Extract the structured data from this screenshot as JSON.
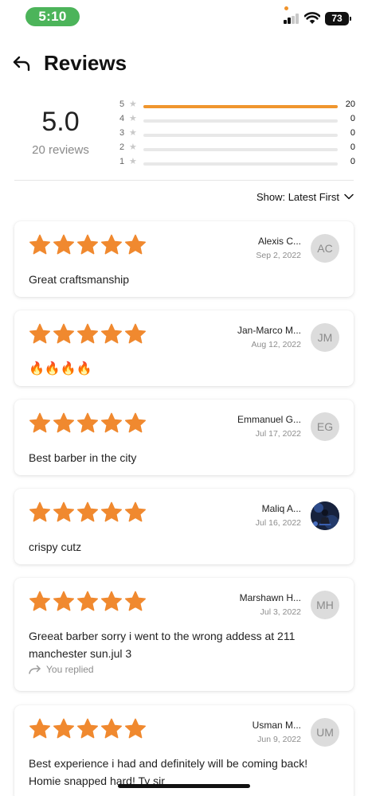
{
  "status_bar": {
    "time": "5:10",
    "battery": "73"
  },
  "header": {
    "title": "Reviews",
    "back_icon": "back-arrow-icon"
  },
  "summary": {
    "average": "5.0",
    "count_label": "20 reviews",
    "distribution": [
      {
        "stars": "5",
        "count": "20",
        "fraction": 1.0
      },
      {
        "stars": "4",
        "count": "0",
        "fraction": 0
      },
      {
        "stars": "3",
        "count": "0",
        "fraction": 0
      },
      {
        "stars": "2",
        "count": "0",
        "fraction": 0
      },
      {
        "stars": "1",
        "count": "0",
        "fraction": 0
      }
    ]
  },
  "sort": {
    "label": "Show: Latest First"
  },
  "colors": {
    "accent": "#f0962e",
    "star": "#f0892f",
    "time_pill": "#4cb45a"
  },
  "reviews": [
    {
      "rating": 5,
      "name": "Alexis C...",
      "date": "Sep 2, 2022",
      "initials": "AC",
      "text": "Great craftsmanship"
    },
    {
      "rating": 5,
      "name": "Jan-Marco M...",
      "date": "Aug 12, 2022",
      "initials": "JM",
      "text": "🔥🔥🔥🔥"
    },
    {
      "rating": 5,
      "name": "Emmanuel G...",
      "date": "Jul 17, 2022",
      "initials": "EG",
      "text": "Best barber in the city"
    },
    {
      "rating": 5,
      "name": "Maliq A...",
      "date": "Jul 16, 2022",
      "initials": "",
      "text": "crispy cutz"
    },
    {
      "rating": 5,
      "name": "Marshawn H...",
      "date": "Jul 3, 2022",
      "initials": "MH",
      "text": "Greeat barber sorry i went to the wrong addess at 211 manchester sun.jul 3",
      "reply_label": "You replied"
    },
    {
      "rating": 5,
      "name": "Usman M...",
      "date": "Jun 9, 2022",
      "initials": "UM",
      "text": "Best experience i had and definitely will be coming back! Homie snapped hard! Ty sir"
    }
  ]
}
